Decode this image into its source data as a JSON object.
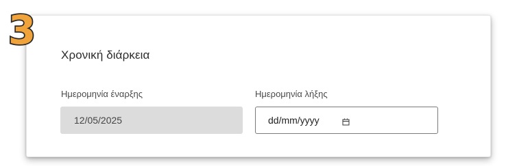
{
  "step": {
    "number": "3",
    "color": "#F0A33A"
  },
  "section": {
    "title": "Χρονική διάρκεια"
  },
  "fields": {
    "start_date": {
      "label": "Ημερομηνία έναρξης",
      "value": "12/05/2025",
      "disabled": true
    },
    "end_date": {
      "label": "Ημερομηνία λήξης",
      "placeholder": "dd/mm/yyyy",
      "icon": "calendar-icon"
    }
  },
  "colors": {
    "disabled_fill": "#DCDCDC",
    "input_border": "#7A7A7A",
    "text": "#2B2B2B"
  }
}
